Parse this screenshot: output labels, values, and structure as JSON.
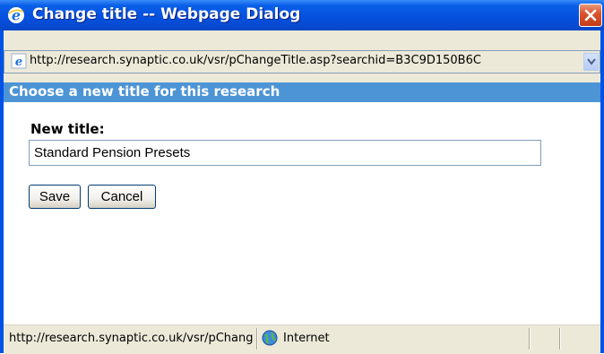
{
  "window": {
    "title": "Change title -- Webpage Dialog",
    "icon": "ie-icon",
    "close_icon": "close-icon"
  },
  "addressbar": {
    "url": "http://research.synaptic.co.uk/vsr/pChangeTitle.asp?searchid=B3C9D150B6C",
    "icon": "ie-page-icon",
    "dropdown_icon": "chevron-down-icon"
  },
  "dialog": {
    "header": "Choose a new title for this research",
    "field_label": "New title:",
    "field_value": "Standard Pension Presets",
    "save_label": "Save",
    "cancel_label": "Cancel"
  },
  "statusbar": {
    "url": "http://research.synaptic.co.uk/vsr/pChangeTi",
    "zone": "Internet",
    "zone_icon": "globe-icon"
  },
  "colors": {
    "titlebar": "#0550de",
    "header_band": "#4d94d6",
    "close_button": "#d9552f",
    "chrome": "#ece9d8"
  }
}
